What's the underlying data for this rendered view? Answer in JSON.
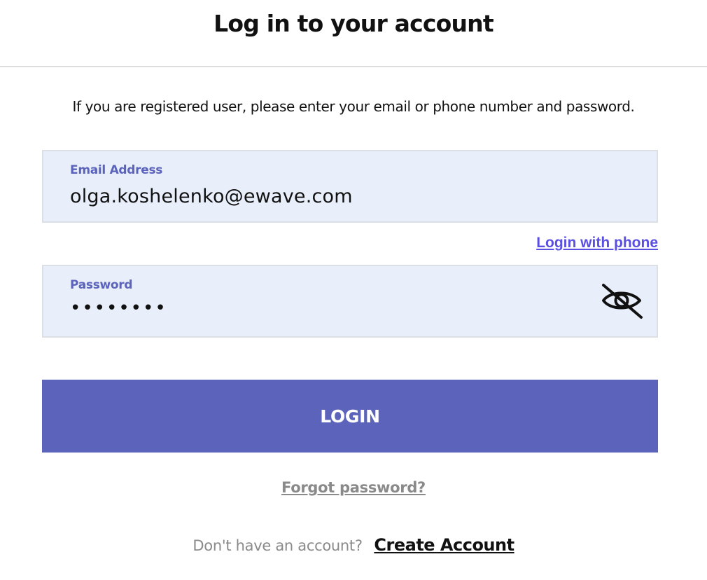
{
  "header": {
    "title": "Log in to your account"
  },
  "intro_text": "If you are registered user, please enter your email or phone number and password.",
  "email_field": {
    "label": "Email Address",
    "value": "olga.koshelenko@ewave.com"
  },
  "login_with_phone_label": "Login with phone",
  "password_field": {
    "label": "Password",
    "value": "••••••••",
    "toggle_icon": "eye-slash-icon"
  },
  "login_button_label": "LOGIN",
  "forgot_password_label": "Forgot password?",
  "signup": {
    "prompt": "Don't have an account?",
    "link_label": "Create Account"
  },
  "colors": {
    "accent": "#5b63bb",
    "field_background": "#e8effb",
    "link": "#5a4fe0",
    "muted_text": "#8a8a8a"
  }
}
